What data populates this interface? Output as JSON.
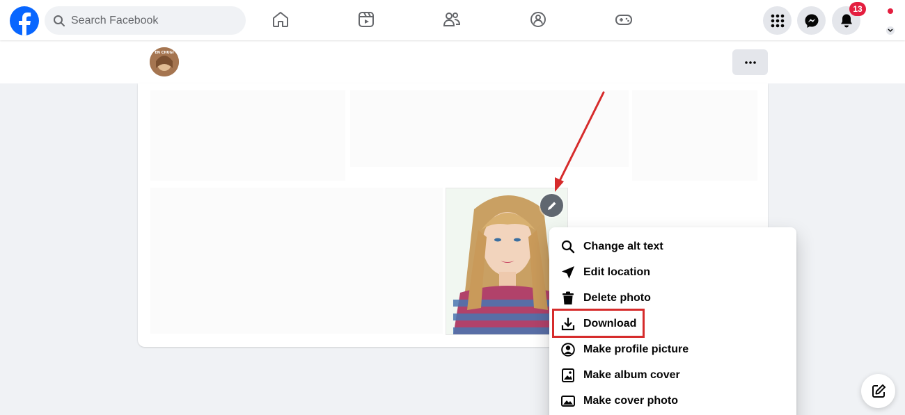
{
  "navbar": {
    "search_placeholder": "Search Facebook",
    "notification_count": "13",
    "icons": [
      "facebook-logo",
      "home-icon",
      "video-icon",
      "friends-icon",
      "groups-icon",
      "gaming-icon",
      "menu-grid-icon",
      "messenger-icon",
      "bell-icon"
    ]
  },
  "avatar_badge_text": "EN CHUGI",
  "post": {
    "author_name": ""
  },
  "photo_menu": {
    "items": [
      {
        "label": "Change alt text",
        "icon": "search-icon"
      },
      {
        "label": "Edit location",
        "icon": "location-arrow-icon"
      },
      {
        "label": "Delete photo",
        "icon": "trash-icon"
      },
      {
        "label": "Download",
        "icon": "download-icon"
      },
      {
        "label": "Make profile picture",
        "icon": "profile-circle-icon"
      },
      {
        "label": "Make album cover",
        "icon": "album-icon"
      },
      {
        "label": "Make cover photo",
        "icon": "cover-photo-icon"
      }
    ],
    "highlighted_item": "Download"
  },
  "colors": {
    "brand_blue": "#0866ff",
    "badge_red": "#e41e3f",
    "annotation_red": "#d62b2b",
    "page_bg": "#f0f2f5"
  }
}
